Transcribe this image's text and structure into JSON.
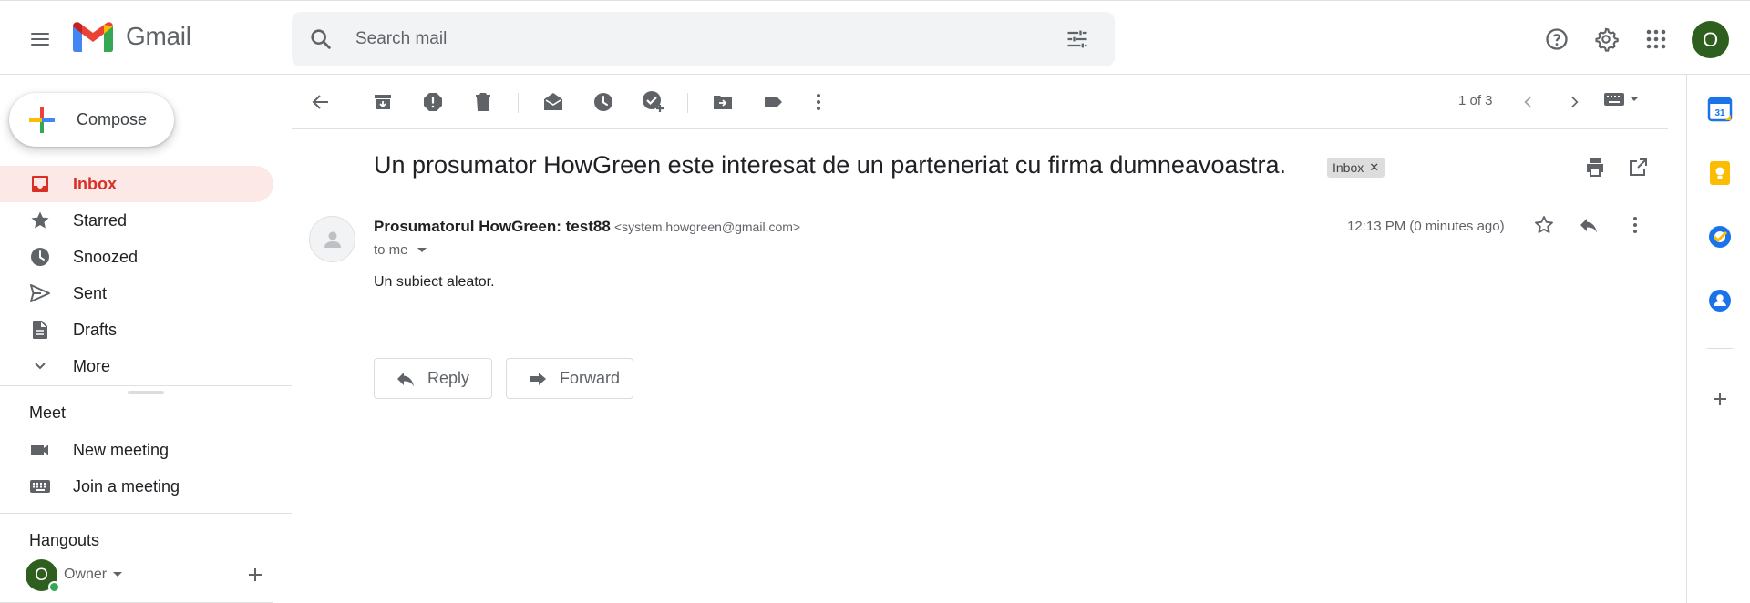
{
  "app": {
    "name": "Gmail"
  },
  "search": {
    "placeholder": "Search mail"
  },
  "header": {
    "avatar_initial": "O"
  },
  "sidebar": {
    "compose_label": "Compose",
    "items": [
      {
        "label": "Inbox",
        "icon": "inbox-icon",
        "active": true
      },
      {
        "label": "Starred",
        "icon": "star-icon"
      },
      {
        "label": "Snoozed",
        "icon": "clock-icon"
      },
      {
        "label": "Sent",
        "icon": "send-icon"
      },
      {
        "label": "Drafts",
        "icon": "draft-icon"
      },
      {
        "label": "More",
        "icon": "chevron-down-icon"
      }
    ],
    "meet": {
      "title": "Meet",
      "new_meeting": "New meeting",
      "join_meeting": "Join a meeting"
    },
    "hangouts": {
      "title": "Hangouts",
      "user_initial": "O",
      "user_name": "Owner"
    }
  },
  "toolbar": {
    "pager": "1 of 3"
  },
  "email": {
    "subject": "Un prosumator HowGreen este interesat de un parteneriat cu firma dumneavoastra.",
    "label_chip": "Inbox",
    "sender_name": "Prosumatorul HowGreen: test88",
    "sender_email": "<system.howgreen@gmail.com>",
    "to": "to me",
    "time": "12:13 PM (0 minutes ago)",
    "body": "Un subiect aleator.",
    "reply_label": "Reply",
    "forward_label": "Forward"
  },
  "colors": {
    "active_nav_bg": "#fce8e6",
    "active_nav_text": "#d93025",
    "avatar_bg": "#2e5f1f",
    "search_bg": "#f1f3f4"
  }
}
